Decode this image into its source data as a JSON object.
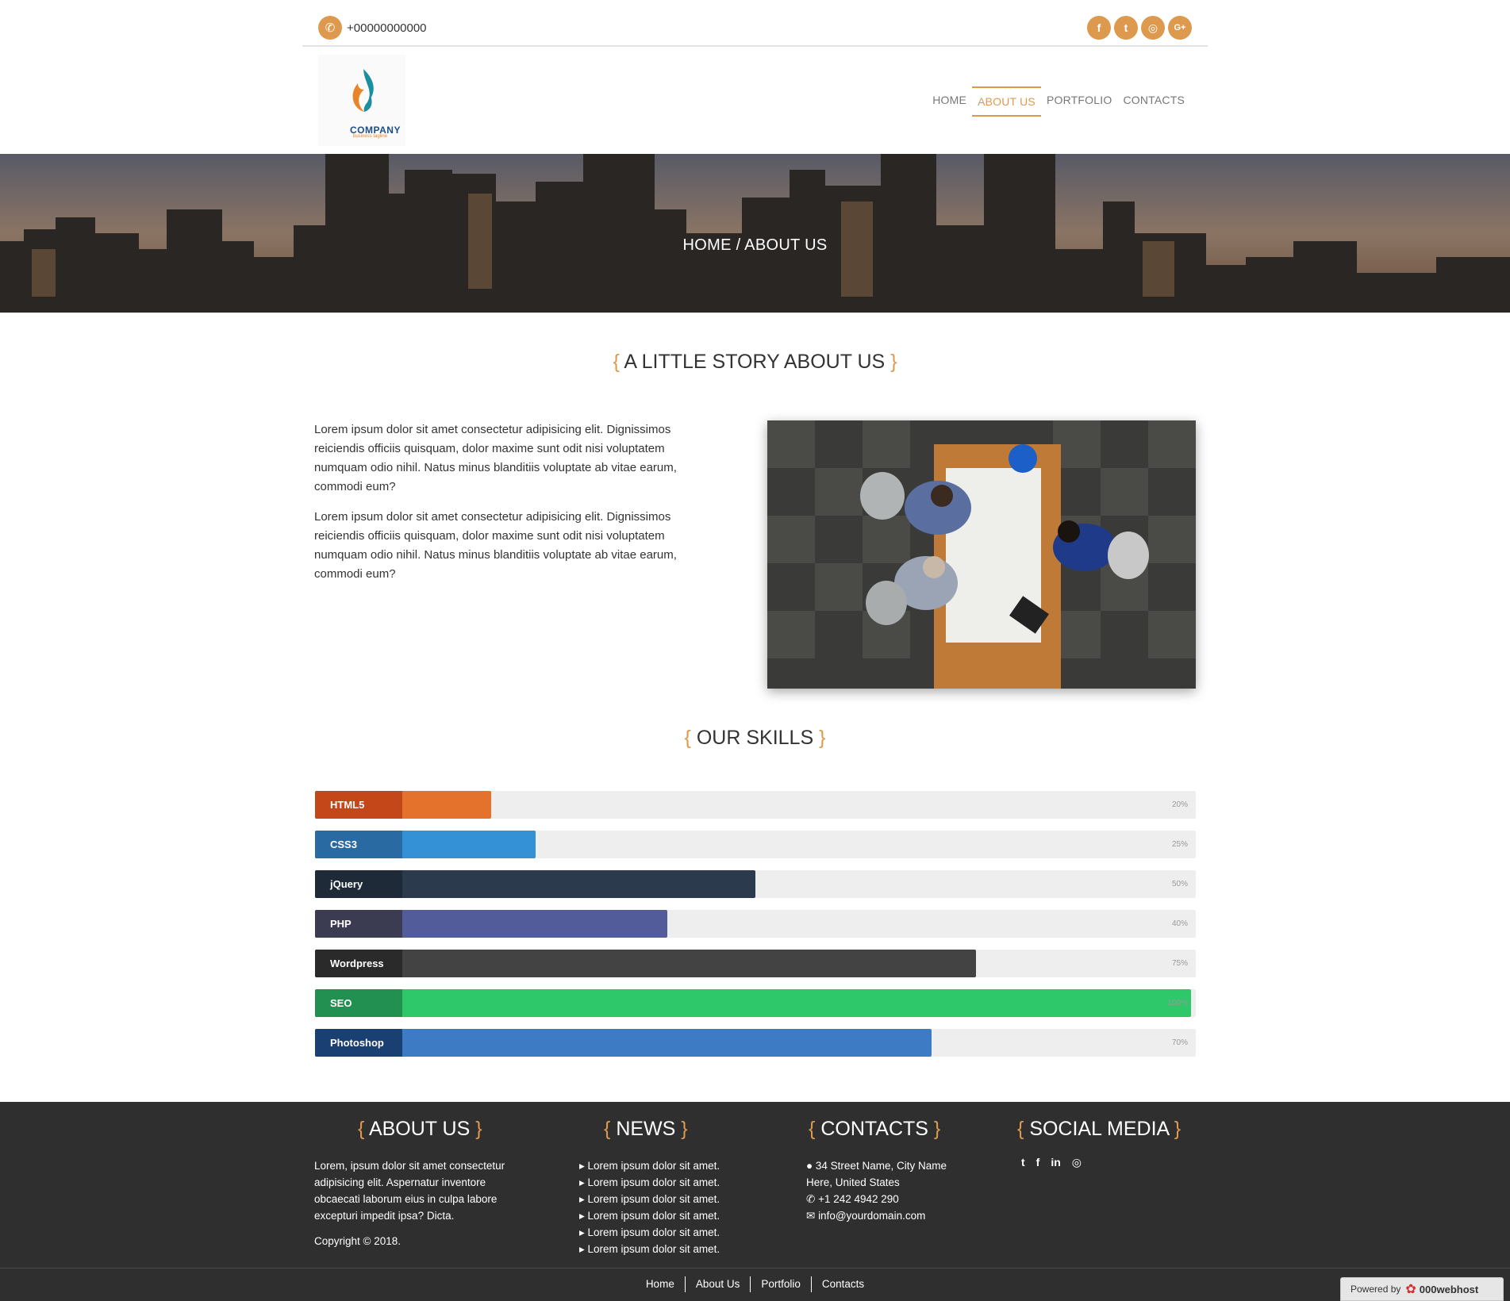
{
  "topbar": {
    "phone": "+00000000000",
    "social_icons": [
      "facebook-icon",
      "twitter-icon",
      "instagram-icon",
      "google-plus-icon"
    ],
    "social_glyphs": [
      "f",
      "t",
      "◎",
      "G+"
    ]
  },
  "header": {
    "logo_name": "COMPANY",
    "logo_tagline": "business tagline",
    "nav": [
      "HOME",
      "ABOUT US",
      "PORTFOLIO",
      "CONTACTS"
    ],
    "active_nav": "ABOUT US"
  },
  "hero": {
    "breadcrumb": "HOME / ABOUT US"
  },
  "story": {
    "title": "A LITTLE STORY ABOUT US",
    "paragraphs": [
      "Lorem ipsum dolor sit amet consectetur adipisicing elit. Dignissimos reiciendis officiis quisquam, dolor maxime sunt odit nisi voluptatem numquam odio nihil. Natus minus blanditiis voluptate ab vitae earum, commodi eum?",
      "Lorem ipsum dolor sit amet consectetur adipisicing elit. Dignissimos reiciendis officiis quisquam, dolor maxime sunt odit nisi voluptatem numquam odio nihil. Natus minus blanditiis voluptate ab vitae earum, commodi eum?"
    ]
  },
  "skills": {
    "title": "OUR SKILLS",
    "items": [
      {
        "name": "HTML5",
        "percent": 20,
        "pct_label": "20%",
        "label_color": "#c4471a",
        "bar_color": "#e4722d"
      },
      {
        "name": "CSS3",
        "percent": 25,
        "pct_label": "25%",
        "label_color": "#2a6aa3",
        "bar_color": "#3591d5"
      },
      {
        "name": "jQuery",
        "percent": 50,
        "pct_label": "50%",
        "label_color": "#1e2a38",
        "bar_color": "#2b3a4d"
      },
      {
        "name": "PHP",
        "percent": 40,
        "pct_label": "40%",
        "label_color": "#3b3c52",
        "bar_color": "#525c9b"
      },
      {
        "name": "Wordpress",
        "percent": 75,
        "pct_label": "75%",
        "label_color": "#2a2a2a",
        "bar_color": "#434343"
      },
      {
        "name": "SEO",
        "percent": 100,
        "pct_label": "100%",
        "label_color": "#229050",
        "bar_color": "#2ec86a"
      },
      {
        "name": "Photoshop",
        "percent": 70,
        "pct_label": "70%",
        "label_color": "#1a3f73",
        "bar_color": "#3d7cc5"
      }
    ]
  },
  "footer": {
    "about_title": "ABOUT US",
    "about_text": "Lorem, ipsum dolor sit amet consectetur adipisicing elit. Aspernatur inventore obcaecati laborum eius in culpa labore excepturi impedit ipsa? Dicta.",
    "copyright": "Copyright © 2018.",
    "news_title": "NEWS",
    "news_items": [
      "Lorem ipsum dolor sit amet.",
      "Lorem ipsum dolor sit amet.",
      "Lorem ipsum dolor sit amet.",
      "Lorem ipsum dolor sit amet.",
      "Lorem ipsum dolor sit amet.",
      "Lorem ipsum dolor sit amet."
    ],
    "contacts_title": "CONTACTS",
    "address": "34 Street Name, City Name Here, United States",
    "phone": "+1 242 4942 290",
    "email": "info@yourdomain.com",
    "social_title": "SOCIAL MEDIA",
    "social_icons": [
      "twitter-icon",
      "facebook-icon",
      "linkedin-icon",
      "instagram-icon"
    ],
    "social_glyphs": [
      "t",
      "f",
      "in",
      "◎"
    ]
  },
  "bottom_nav": [
    "Home",
    "About Us",
    "Portfolio",
    "Contacts"
  ],
  "powered": {
    "prefix": "Powered by",
    "brand": "000webhost"
  },
  "colors": {
    "accent": "#dd9a4e",
    "footer_bg": "#2f2f2f"
  }
}
